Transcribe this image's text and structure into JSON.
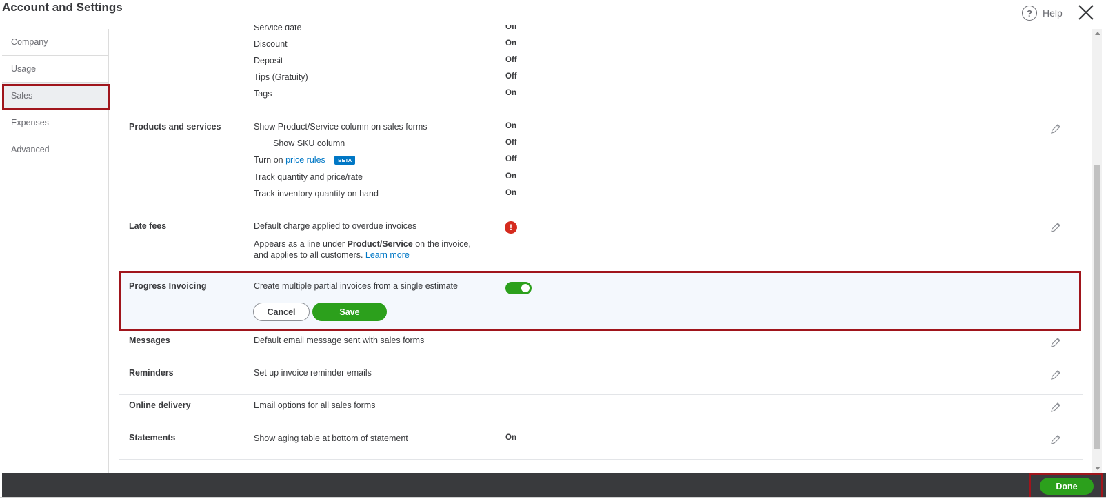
{
  "window": {
    "title": "Account and Settings",
    "help_label": "Help",
    "help_icon": "?"
  },
  "sidebar": {
    "items": [
      {
        "label": "Company"
      },
      {
        "label": "Usage"
      },
      {
        "label": "Sales",
        "active": true
      },
      {
        "label": "Expenses"
      },
      {
        "label": "Advanced"
      }
    ]
  },
  "sections": {
    "customization": {
      "rows": [
        {
          "label": "Service date",
          "value": "Off"
        },
        {
          "label": "Discount",
          "value": "On"
        },
        {
          "label": "Deposit",
          "value": "Off"
        },
        {
          "label": "Tips (Gratuity)",
          "value": "Off"
        },
        {
          "label": "Tags",
          "value": "On"
        }
      ]
    },
    "products": {
      "title": "Products and services",
      "rows": [
        {
          "label": "Show Product/Service column on sales forms",
          "value": "On"
        },
        {
          "label": "Show SKU column",
          "value": "Off"
        },
        {
          "label_prefix": "Turn on",
          "link": "price rules",
          "badge": "BETA",
          "value": "Off"
        },
        {
          "label": "Track quantity and price/rate",
          "value": "On"
        },
        {
          "label": "Track inventory quantity on hand",
          "value": "On"
        }
      ]
    },
    "late_fees": {
      "title": "Late fees",
      "description": "Default charge applied to overdue invoices",
      "error_icon": "!",
      "note_line1_prefix": "Appears as a line under",
      "note_line1_bold": "Product/Service",
      "note_line1_suffix": "on the invoice,",
      "note_line2": "and applies to all customers.",
      "learn_more": "Learn more"
    },
    "progress_invoicing": {
      "title": "Progress Invoicing",
      "description": "Create multiple partial invoices from a single estimate",
      "toggle_on": true,
      "cancel_label": "Cancel",
      "save_label": "Save"
    },
    "messages": {
      "title": "Messages",
      "description": "Default email message sent with sales forms"
    },
    "reminders": {
      "title": "Reminders",
      "description": "Set up invoice reminder emails"
    },
    "online_delivery": {
      "title": "Online delivery",
      "description": "Email options for all sales forms"
    },
    "statements": {
      "title": "Statements",
      "description": "Show aging table at bottom of statement",
      "value": "On"
    }
  },
  "footer": {
    "done_label": "Done"
  },
  "colors": {
    "accent_green": "#2ca01c",
    "link_blue": "#0077c5",
    "highlight_red": "#a0151c",
    "footer_dark": "#393a3d",
    "error_red": "#d52b1e"
  }
}
